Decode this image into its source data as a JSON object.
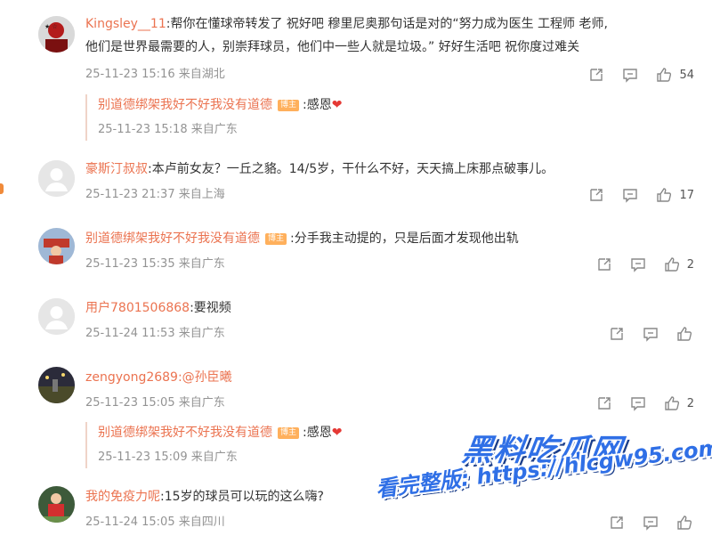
{
  "comments": [
    {
      "user": "Kingsley__11",
      "text_line1": ":帮你在懂球帝转发了 祝好吧 穆里尼奥那句话是对的“努力成为医生 工程师 老师,",
      "text_line2": "他们是世界最需要的人，别崇拜球员，他们中一些人就是垃圾。” 好好生活吧 祝你度过难关",
      "time": "25-11-23 15:16 来自湖北",
      "likes": "54",
      "reply": {
        "user": "别道德绑架我好不好我没有道德",
        "badge": "博主",
        "text": ":感恩",
        "time": "25-11-23 15:18 来自广东"
      }
    },
    {
      "user": "豪斯汀叔叔",
      "text_line1": ":本卢前女友？一丘之貉。14/5岁，干什么不好，天天搞上床那点破事儿。",
      "time": "25-11-23 21:37 来自上海",
      "likes": "17"
    },
    {
      "user": "别道德绑架我好不好我没有道德",
      "badge": "博主",
      "text_line1": ":分手我主动提的，只是后面才发现他出轨",
      "time": "25-11-23 15:35 来自广东",
      "likes": "2"
    },
    {
      "user": "用户7801506868",
      "text_line1": ":要视频",
      "time": "25-11-24 11:53 来自广东",
      "likes": ""
    },
    {
      "user": "zengyong2689",
      "text_line1": ":@孙臣曦",
      "time": "25-11-23 15:05 来自广东",
      "likes": "2",
      "reply": {
        "user": "别道德绑架我好不好我没有道德",
        "badge": "博主",
        "text": ":感恩",
        "time": "25-11-23 15:09 来自广东"
      }
    },
    {
      "user": "我的免疫力呢",
      "text_line1": ":15岁的球员可以玩的这么嗨?",
      "time": "25-11-24 15:05 来自四川",
      "likes": ""
    }
  ],
  "heart": "❤",
  "watermark": {
    "title": "黑料吃瓜网",
    "url_line": "看完整版: https://hlcgw95.com"
  },
  "icons": [
    "share-icon",
    "comment-icon",
    "like-icon"
  ],
  "colors": {
    "username": "#eb7350",
    "meta": "#939393",
    "badge": "#ffb05c",
    "watermark": "#2f6fe6"
  }
}
